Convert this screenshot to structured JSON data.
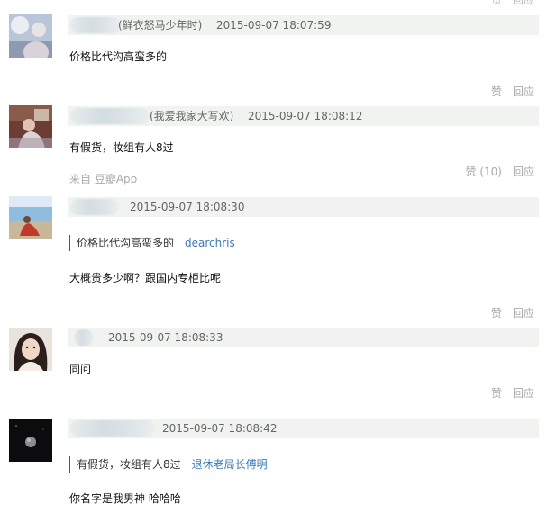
{
  "top_actions": {
    "like": "赞",
    "reply": "回应"
  },
  "comments": [
    {
      "nickname": "(鲜衣怒马少年时)",
      "time": "2015-09-07 18:07:59",
      "quote_text": "",
      "quote_author": "",
      "text": "价格比代沟高蛮多的",
      "source": "",
      "like_label": "赞",
      "reply_label": "回应"
    },
    {
      "nickname": "(我爱我家大写欢)",
      "time": "2015-09-07 18:08:12",
      "quote_text": "",
      "quote_author": "",
      "text": "有假货，妆组有人8过",
      "source": "来自 豆瓣App",
      "like_label": "赞 (10)",
      "reply_label": "回应"
    },
    {
      "nickname": "",
      "time": "2015-09-07 18:08:30",
      "quote_text": "价格比代沟高蛮多的",
      "quote_author": "dearchris",
      "text": "大概贵多少啊？跟国内专柜比呢",
      "source": "",
      "like_label": "赞",
      "reply_label": "回应"
    },
    {
      "nickname": "",
      "time": "2015-09-07 18:08:33",
      "quote_text": "",
      "quote_author": "",
      "text": "同问",
      "source": "",
      "like_label": "赞",
      "reply_label": "回应"
    },
    {
      "nickname": "",
      "time": "2015-09-07 18:08:42",
      "quote_text": "有假货，妆组有人8过",
      "quote_author": "退休老局长傅明",
      "text": "你名字是我男神 哈哈哈",
      "source": "",
      "like_label": "",
      "reply_label": ""
    }
  ],
  "colors": {
    "meta_bg": "#f0f3ef",
    "link": "#3d7ab8",
    "muted": "#aaaaaa"
  }
}
